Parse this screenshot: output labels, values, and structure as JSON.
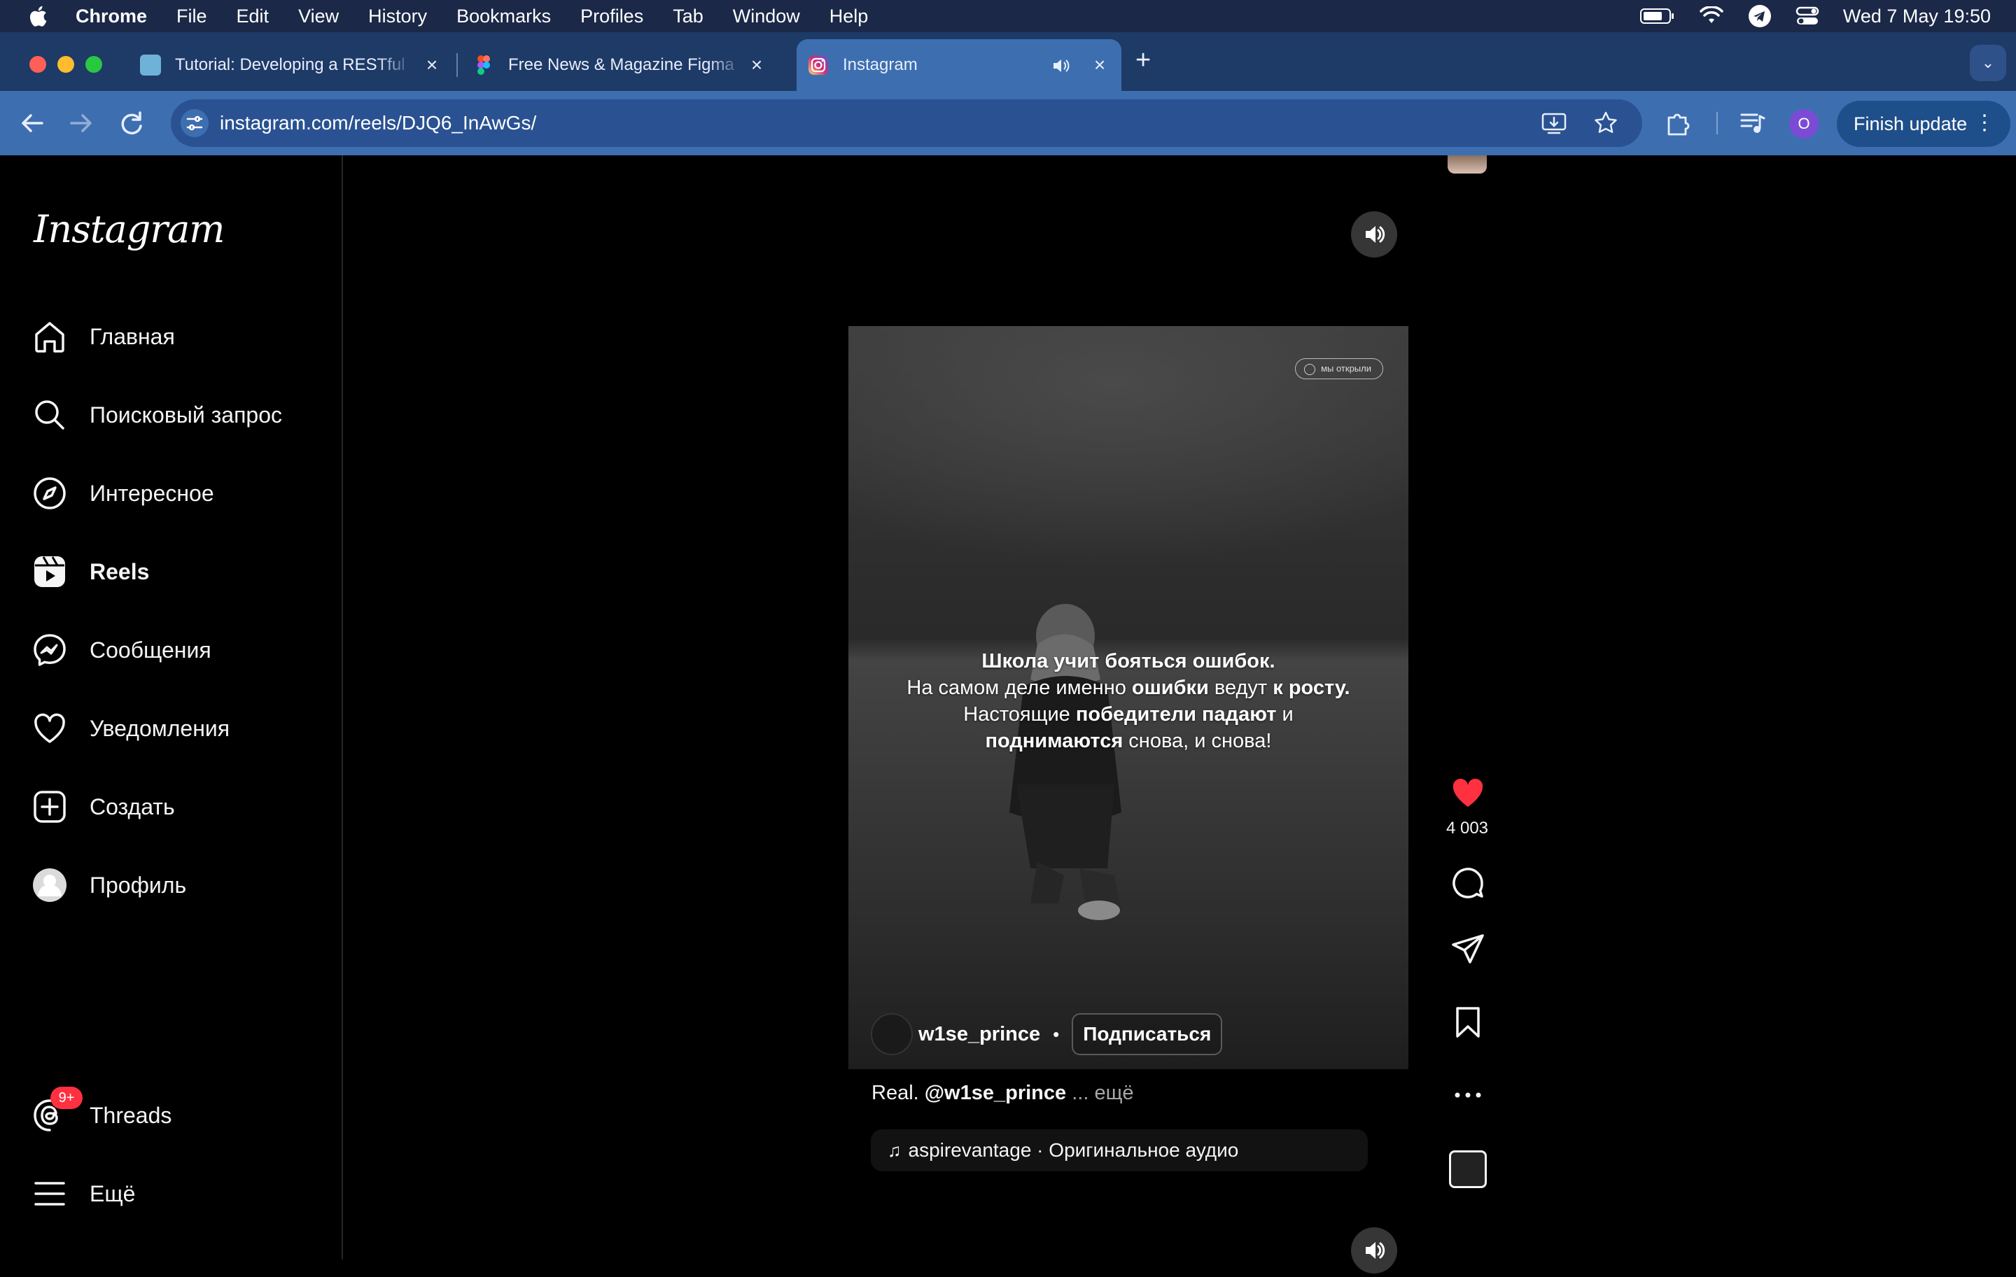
{
  "menubar": {
    "app": "Chrome",
    "items": [
      "File",
      "Edit",
      "View",
      "History",
      "Bookmarks",
      "Profiles",
      "Tab",
      "Window",
      "Help"
    ],
    "clock": "Wed 7 May  19:50"
  },
  "tabs": [
    {
      "title": "Tutorial: Developing a RESTful",
      "close": "×"
    },
    {
      "title": "Free News & Magazine Figma",
      "close": "×"
    },
    {
      "title": "Instagram",
      "close": "×"
    }
  ],
  "toolbar": {
    "url": "instagram.com/reels/DJQ6_InAwGs/",
    "profile_initial": "O",
    "finish_update": "Finish update"
  },
  "sidebar": {
    "logo": "Instagram",
    "items": [
      {
        "label": "Главная"
      },
      {
        "label": "Поисковый запрос"
      },
      {
        "label": "Интересное"
      },
      {
        "label": "Reels"
      },
      {
        "label": "Сообщения"
      },
      {
        "label": "Уведомления"
      },
      {
        "label": "Создать"
      },
      {
        "label": "Профиль"
      }
    ],
    "threads": {
      "label": "Threads",
      "badge": "9+"
    },
    "more": {
      "label": "Ещё"
    }
  },
  "reel": {
    "telegram_pill": "мы открыли",
    "quote": {
      "line1_bold": "Школа учит бояться ошибок.",
      "line2_a": "На самом деле именно ",
      "line2_b": "ошибки",
      "line2_c": " ведут ",
      "line2_d": "к росту.",
      "line3_a": "Настоящие ",
      "line3_b": "победители падают",
      "line3_c": " и",
      "line4_a": "поднимаются",
      "line4_b": " снова, и снова!"
    },
    "author": "w1se_prince",
    "author_dot": "•",
    "follow": "Подписаться",
    "caption_prefix": "Real. ",
    "caption_mention": "@w1se_prince",
    "caption_more": " ... ещё",
    "audio": "aspirevantage · Оригинальное аудио",
    "likes": "4 003"
  },
  "colors": {
    "like": "#ff3040",
    "menubar": "#1b2847",
    "tabstrip": "#1e3a66",
    "toolbar": "#3d6fb0"
  },
  "icons": [
    "apple-icon",
    "battery-icon",
    "wifi-icon",
    "telegram-icon",
    "control-center-icon",
    "home-icon",
    "search-icon",
    "compass-icon",
    "reels-icon",
    "messenger-icon",
    "heart-icon",
    "plus-square-icon",
    "threads-icon",
    "menu-icon",
    "speaker-icon",
    "comment-icon",
    "share-icon",
    "bookmark-icon",
    "more-icon"
  ]
}
